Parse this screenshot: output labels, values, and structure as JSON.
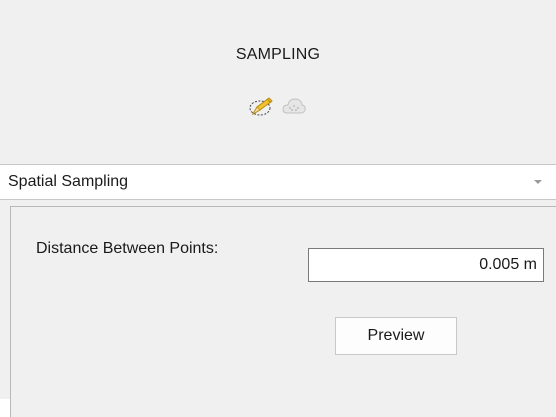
{
  "panel": {
    "title": "SAMPLING",
    "icons": [
      "edit-pencil-icon",
      "cloud-sampling-icon"
    ]
  },
  "mode_select": {
    "selected": "Spatial Sampling"
  },
  "settings": {
    "distance_label": "Distance Between Points:",
    "distance_value": "0.005 m",
    "preview_label": "Preview"
  },
  "colors": {
    "panel_bg": "#f0f0f0",
    "pencil_yellow": "#f2c230",
    "icon_disabled_gray": "#c8c8c8"
  }
}
